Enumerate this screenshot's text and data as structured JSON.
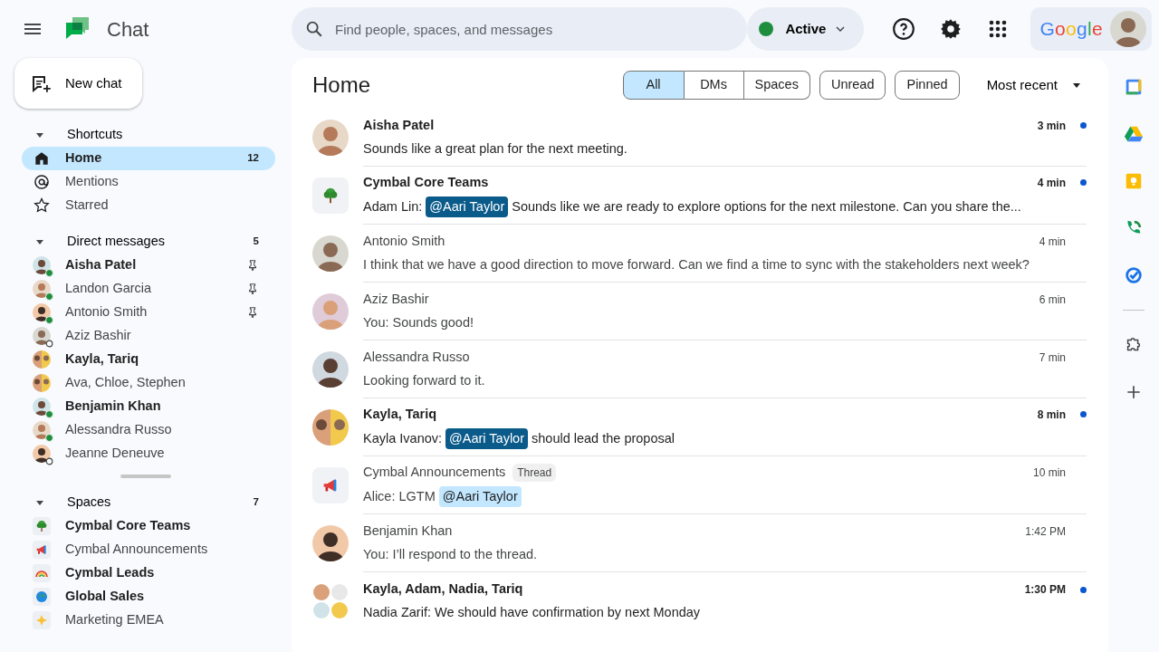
{
  "app": {
    "title": "Chat"
  },
  "search": {
    "placeholder": "Find people, spaces, and messages"
  },
  "status": {
    "label": "Active",
    "on": true
  },
  "account": {
    "logo": "Google"
  },
  "new_chat": {
    "label": "New chat"
  },
  "shortcuts": {
    "title": "Shortcuts",
    "expanded": true,
    "items": [
      {
        "label": "Home",
        "kind": "home",
        "count": "12",
        "selected": true
      },
      {
        "label": "Mentions",
        "kind": "at",
        "selected": false
      },
      {
        "label": "Starred",
        "kind": "star",
        "selected": false
      }
    ]
  },
  "direct_messages": {
    "title": "Direct messages",
    "count": "5",
    "expanded": true,
    "items": [
      {
        "name": "Aisha Patel",
        "unread": true,
        "kind": "online",
        "pinned": true
      },
      {
        "name": "Landon Garcia",
        "unread": false,
        "kind": "online",
        "pinned": true
      },
      {
        "name": "Antonio Smith",
        "unread": false,
        "kind": "online",
        "pinned": true
      },
      {
        "name": "Aziz Bashir",
        "unread": false,
        "kind": "offline",
        "pinned": false
      },
      {
        "name": "Kayla, Tariq",
        "unread": true,
        "pinned": false,
        "kind": "group"
      },
      {
        "name": "Ava, Chloe, Stephen",
        "unread": false,
        "pinned": false,
        "kind": "group"
      },
      {
        "name": "Benjamin Khan",
        "unread": true,
        "kind": "online",
        "pinned": false
      },
      {
        "name": "Alessandra Russo",
        "unread": false,
        "kind": "online",
        "pinned": false
      },
      {
        "name": "Jeanne Deneuve",
        "unread": false,
        "kind": "offline",
        "pinned": false
      }
    ]
  },
  "spaces": {
    "title": "Spaces",
    "count": "7",
    "expanded": true,
    "items": [
      {
        "name": "Cymbal Core Teams",
        "unread": true,
        "kind": "tree"
      },
      {
        "name": "Cymbal Announcements",
        "unread": false,
        "kind": "megaphone"
      },
      {
        "name": "Cymbal Leads",
        "unread": true,
        "kind": "rainbow"
      },
      {
        "name": "Global Sales",
        "unread": true,
        "kind": "globe"
      },
      {
        "name": "Marketing EMEA",
        "unread": false,
        "kind": "sparkle"
      }
    ]
  },
  "home": {
    "title": "Home",
    "filters": [
      {
        "label": "All",
        "kind": "segment",
        "selected": true
      },
      {
        "label": "DMs",
        "kind": "segment",
        "selected": false
      },
      {
        "label": "Spaces",
        "kind": "segment",
        "selected": false
      },
      {
        "label": "Unread",
        "kind": "chip",
        "selected": false
      },
      {
        "label": "Pinned",
        "kind": "chip",
        "selected": false
      }
    ],
    "sort": "Most recent",
    "messages": [
      {
        "title": "Aisha Patel",
        "kind": "person",
        "unread": true,
        "time": "3 min",
        "preview": [
          {
            "kind": "text",
            "text": "Sounds like a great plan for the next meeting."
          }
        ]
      },
      {
        "title": "Cymbal Core Teams",
        "kind": "tree",
        "unread": true,
        "time": "4 min",
        "preview": [
          {
            "kind": "text",
            "text": "Adam Lin:"
          },
          {
            "kind": "mention",
            "text": "@Aari Taylor"
          },
          {
            "kind": "text",
            "text": "Sounds like we are ready to explore options for the next milestone. Can you share the..."
          }
        ]
      },
      {
        "title": "Antonio Smith",
        "kind": "person",
        "unread": false,
        "time": "4 min",
        "preview": [
          {
            "kind": "text",
            "text": "I think that we have a good direction to move forward. Can we find a time to sync with the stakeholders next week?"
          }
        ]
      },
      {
        "title": "Aziz Bashir",
        "kind": "person",
        "unread": false,
        "time": "6 min",
        "preview": [
          {
            "kind": "text",
            "text": "You: Sounds good!"
          }
        ]
      },
      {
        "title": "Alessandra Russo",
        "kind": "person",
        "unread": false,
        "time": "7 min",
        "preview": [
          {
            "kind": "text",
            "text": "Looking forward to it."
          }
        ]
      },
      {
        "title": "Kayla, Tariq",
        "kind": "pair",
        "unread": true,
        "time": "8 min",
        "preview": [
          {
            "kind": "text",
            "text": "Kayla Ivanov:"
          },
          {
            "kind": "mention",
            "text": "@Aari Taylor"
          },
          {
            "kind": "text",
            "text": "should lead the proposal"
          }
        ]
      },
      {
        "title": "Cymbal Announcements",
        "tag": "Thread",
        "kind": "megaphone",
        "unread": false,
        "time": "10 min",
        "preview": [
          {
            "kind": "text",
            "text": "Alice: LGTM"
          },
          {
            "kind": "mention",
            "text": "@Aari Taylor"
          }
        ]
      },
      {
        "title": "Benjamin Khan",
        "kind": "person",
        "unread": false,
        "time": "1:42 PM",
        "preview": [
          {
            "kind": "text",
            "text": "You: I’ll respond to the thread."
          }
        ]
      },
      {
        "title": "Kayla, Adam, Nadia, Tariq",
        "kind": "quad",
        "unread": true,
        "time": "1:30 PM",
        "preview": [
          {
            "kind": "text",
            "text": "Nadia Zarif: We should have confirmation by next Monday"
          }
        ]
      }
    ]
  }
}
